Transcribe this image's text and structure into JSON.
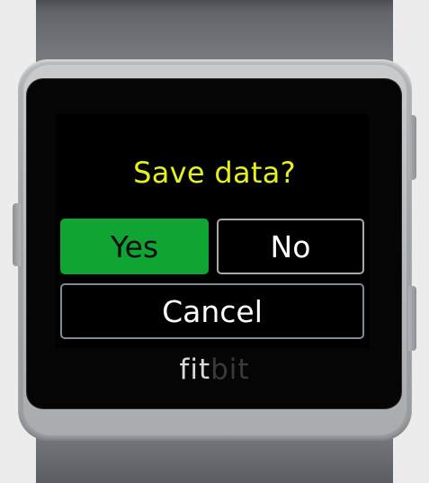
{
  "dialog": {
    "title": "Save data?",
    "yes_label": "Yes",
    "no_label": "No",
    "cancel_label": "Cancel"
  },
  "branding": {
    "logo_part1": "fit",
    "logo_part2": "bit"
  },
  "colors": {
    "title": "#e8f01c",
    "yes_button": "#10a533",
    "screen_background": "#000000"
  }
}
